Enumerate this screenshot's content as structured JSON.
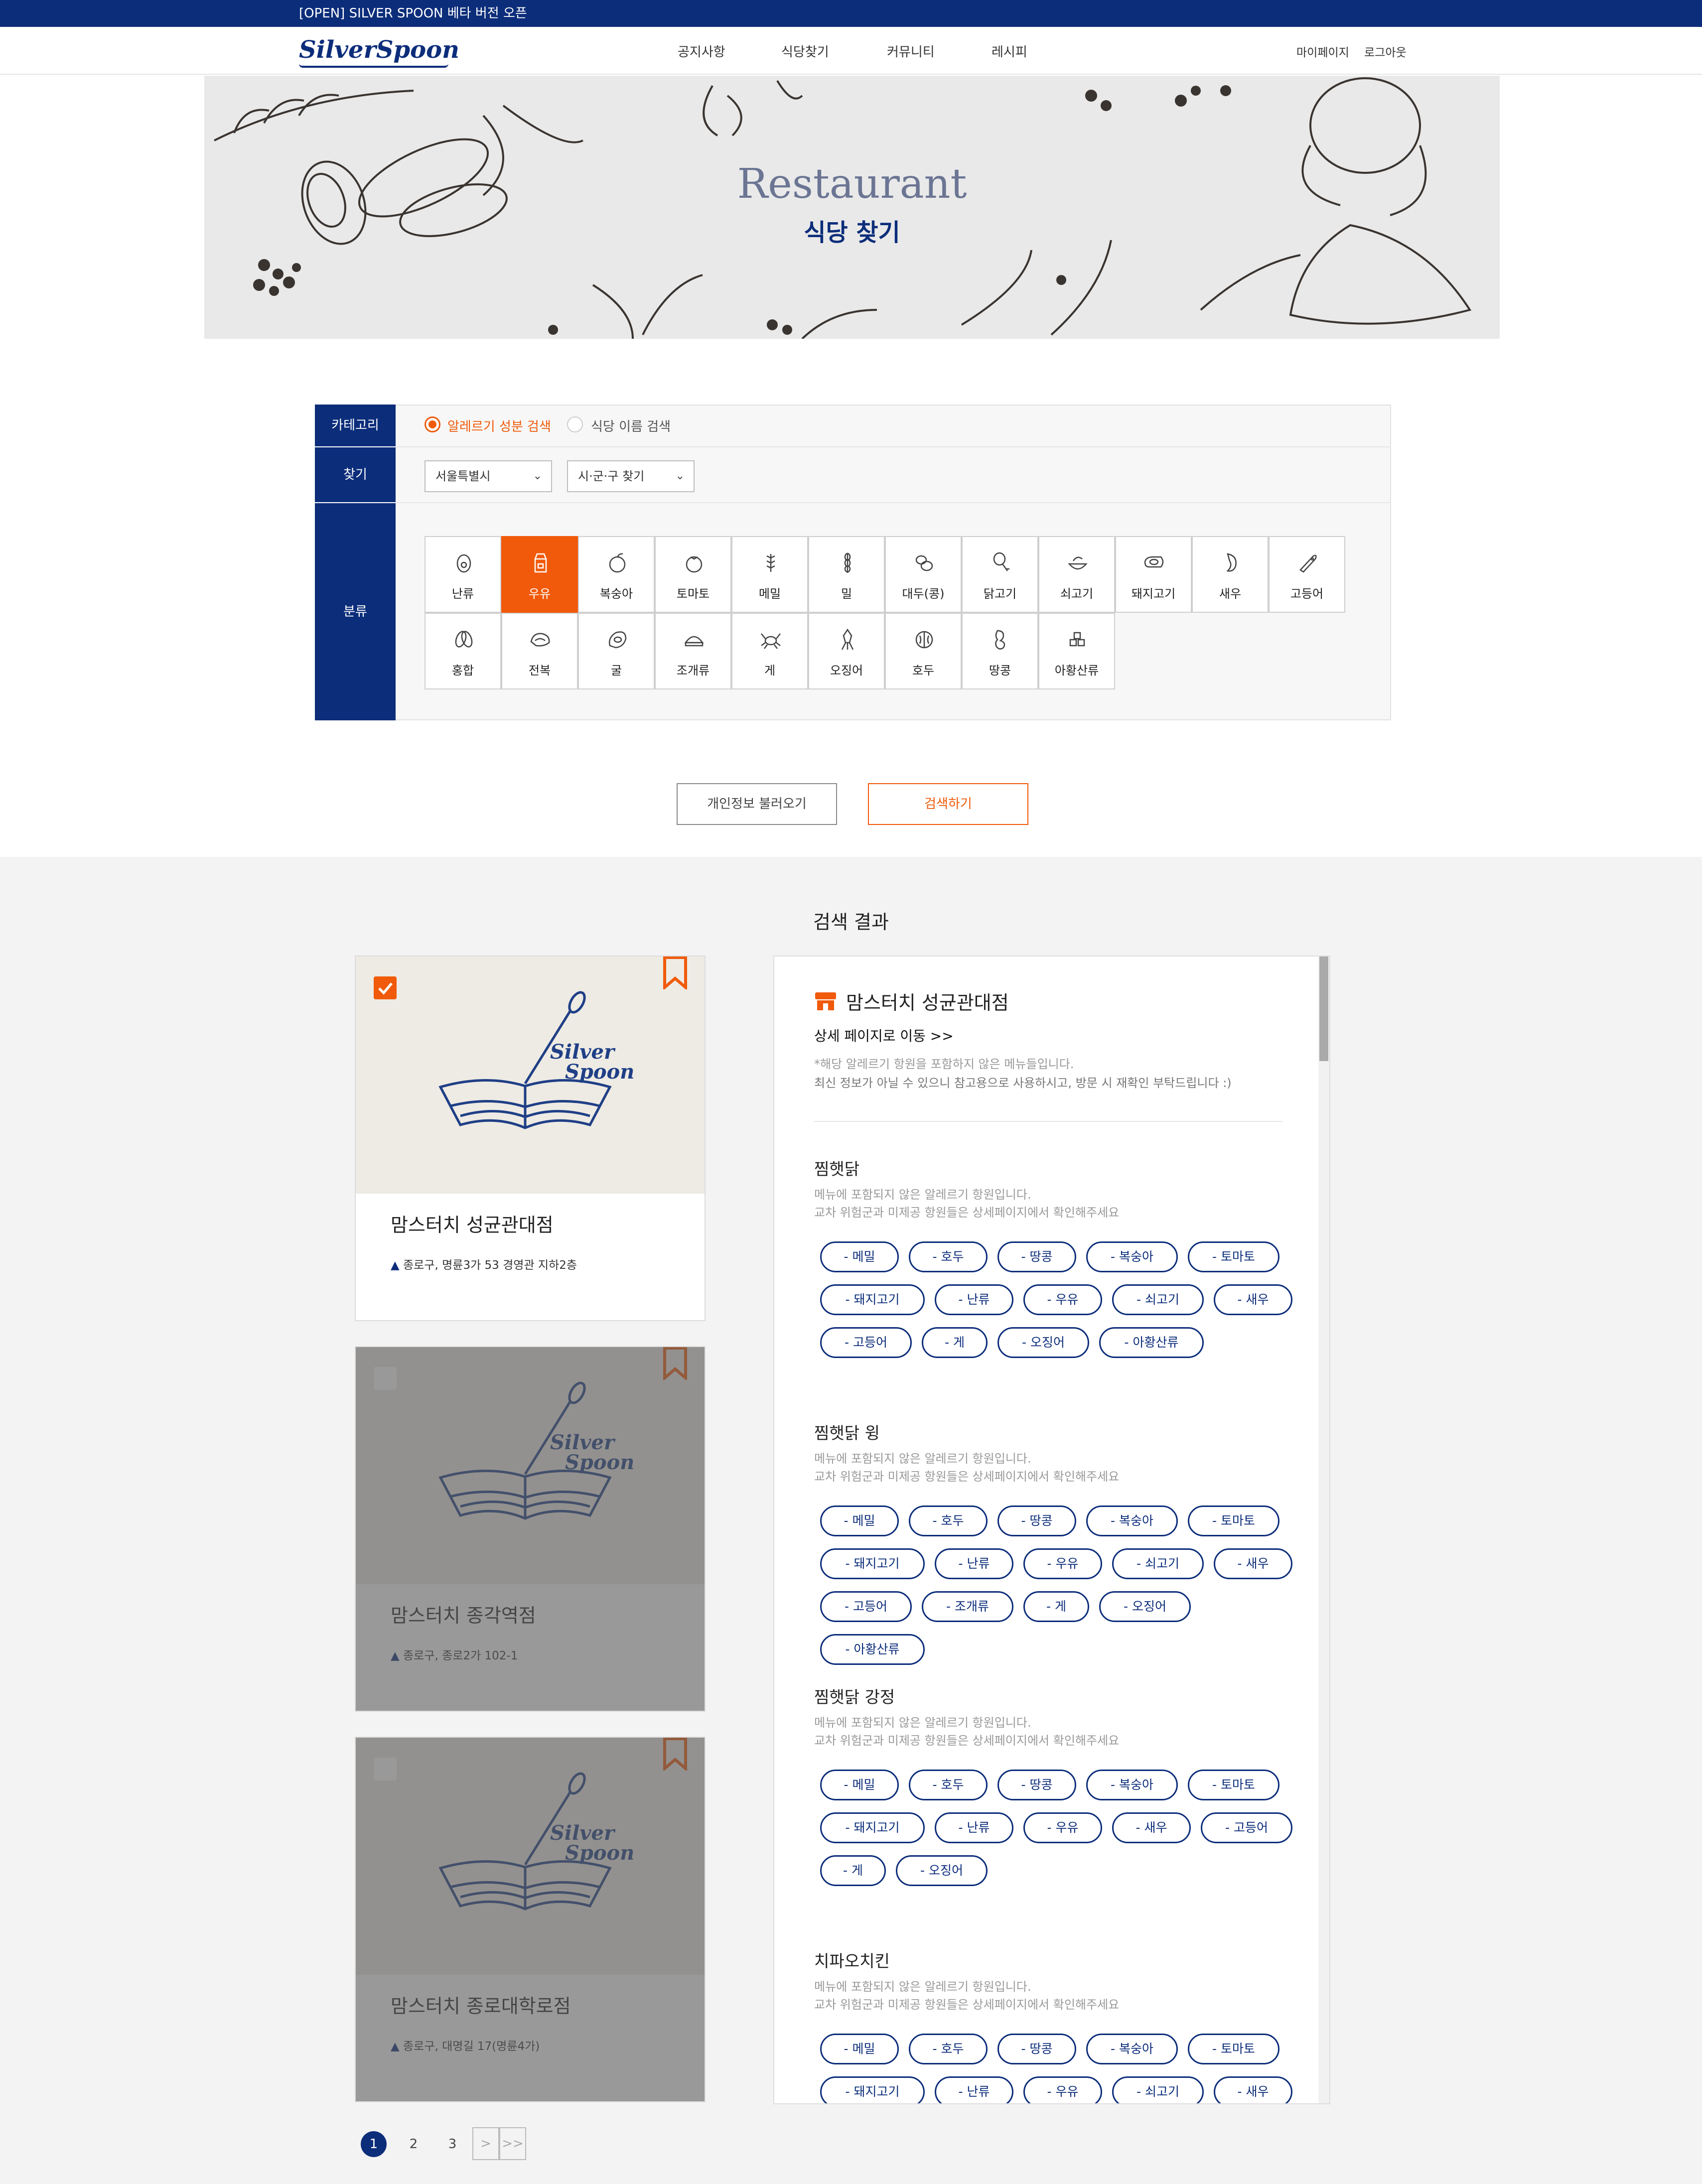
{
  "banner": {
    "text": "[OPEN] SILVER SPOON 베타 버전 오픈"
  },
  "header": {
    "logo": "SilverSpoon",
    "menu": [
      "공지사항",
      "식당찾기",
      "커뮤니티",
      "레시피"
    ],
    "user_menu": [
      "마이페이지",
      "로그아웃"
    ]
  },
  "hero": {
    "title_en": "Restaurant",
    "title_ko": "식당 찾기"
  },
  "filter": {
    "category_label": "카테고리",
    "find_label": "찾기",
    "class_label": "분류",
    "radio_options": [
      "알레르기 성분 검색",
      "식당 이름 검색"
    ],
    "radio_selected": 0,
    "select_city": "서울특별시",
    "select_district": "시·군·구 찾기",
    "allergens": [
      "난류",
      "우유",
      "복숭아",
      "토마토",
      "메밀",
      "밀",
      "대두(콩)",
      "닭고기",
      "쇠고기",
      "돼지고기",
      "새우",
      "고등어",
      "홍합",
      "전복",
      "굴",
      "조개류",
      "게",
      "오징어",
      "호두",
      "땅콩",
      "아황산류"
    ],
    "selected_allergen": 1
  },
  "actions": {
    "load_profile": "개인정보 불러오기",
    "search": "검색하기"
  },
  "results": {
    "title": "검색 결과",
    "cards": [
      {
        "name": "맘스터치 성균관대점",
        "address": "종로구, 명륜3가 53 경영관 지하2층",
        "checked": true
      },
      {
        "name": "맘스터치 종각역점",
        "address": "종로구, 종로2가 102-1",
        "checked": false
      },
      {
        "name": "맘스터치 종로대학로점",
        "address": "종로구, 대명길 17(명륜4가)",
        "checked": false
      }
    ],
    "card_logo_line1": "Silver",
    "card_logo_line2": "Spoon",
    "pagination": [
      "1",
      "2",
      "3",
      ">",
      ">>"
    ]
  },
  "detail": {
    "name": "맘스터치 성균관대점",
    "link": "상세 페이지로 이동 >>",
    "note1": "*해당 알레르기 항원을 포함하지 않은 메뉴들입니다.",
    "note2": "최신 정보가 아닐 수 있으니 참고용으로 사용하시고, 방문 시 재확인 부탁드립니다 :)",
    "menu_sub1": "메뉴에 포함되지 않은 알레르기 항원입니다.",
    "menu_sub2": "교차 위험군과 미제공 항원들은 상세페이지에서 확인해주세요",
    "menus": [
      {
        "title": "찜햇닭",
        "tags": [
          "- 메밀",
          "- 호두",
          "- 땅콩",
          "- 복숭아",
          "- 토마토",
          "- 돼지고기",
          "- 난류",
          "- 우유",
          "- 쇠고기",
          "- 새우",
          "- 고등어",
          "- 게",
          "- 오징어",
          "- 아황산류"
        ]
      },
      {
        "title": "찜햇닭 윙",
        "tags": [
          "- 메밀",
          "- 호두",
          "- 땅콩",
          "- 복숭아",
          "- 토마토",
          "- 돼지고기",
          "- 난류",
          "- 우유",
          "- 쇠고기",
          "- 새우",
          "- 고등어",
          "- 조개류",
          "- 게",
          "- 오징어",
          "- 아황산류"
        ]
      },
      {
        "title": "찜햇닭 강정",
        "tags": [
          "- 메밀",
          "- 호두",
          "- 땅콩",
          "- 복숭아",
          "- 토마토",
          "- 돼지고기",
          "- 난류",
          "- 우유",
          "- 새우",
          "- 고등어",
          "- 게",
          "- 오징어"
        ]
      },
      {
        "title": "치파오치킨",
        "tags": [
          "- 메밀",
          "- 호두",
          "- 땅콩",
          "- 복숭아",
          "- 토마토",
          "- 돼지고기",
          "- 난류",
          "- 우유",
          "- 쇠고기",
          "- 새우"
        ]
      }
    ]
  },
  "colors": {
    "navy": "#0c2d7a",
    "orange": "#f05a0a"
  }
}
